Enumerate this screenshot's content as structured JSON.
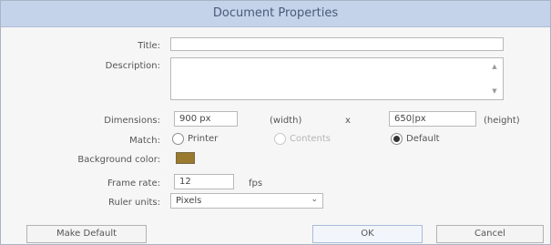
{
  "dialog": {
    "title": "Document Properties"
  },
  "fields": {
    "title_label": "Title:",
    "title_value": "",
    "description_label": "Description:",
    "description_value": "",
    "dimensions_label": "Dimensions:",
    "width_value": "900 px",
    "width_label": "(width)",
    "times_sign": "x",
    "height_value": "650|px",
    "height_label": "(height)",
    "match_label": "Match:",
    "match_options": {
      "printer": "Printer",
      "contents": "Contents",
      "default": "Default"
    },
    "match_selected": "Default",
    "background_color_label": "Background color:",
    "background_color": "#9a7a2e",
    "frame_rate_label": "Frame rate:",
    "frame_rate_value": "12",
    "frame_rate_unit": "fps",
    "ruler_units_label": "Ruler units:",
    "ruler_units_value": "Pixels"
  },
  "buttons": {
    "make_default": "Make Default",
    "ok": "OK",
    "cancel": "Cancel"
  },
  "icons": {
    "scroll_up": "scroll-up-arrow-icon",
    "scroll_down": "scroll-down-arrow-icon",
    "dropdown": "chevron-down-icon"
  }
}
